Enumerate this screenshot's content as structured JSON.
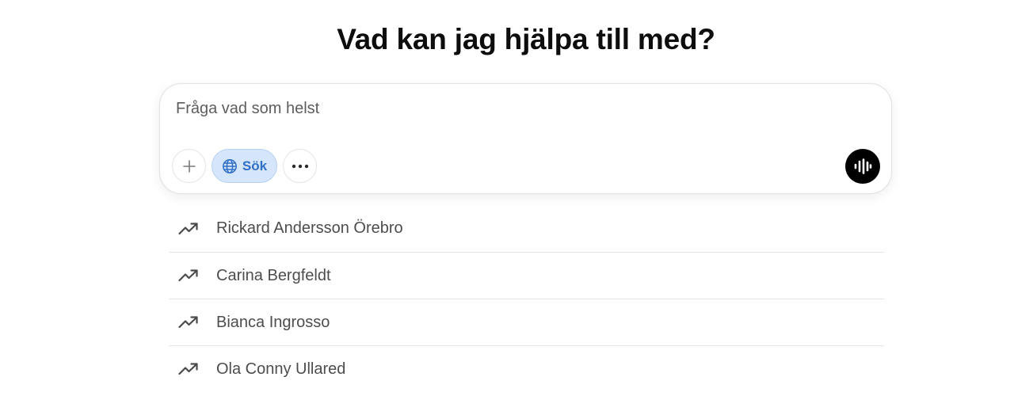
{
  "heading": "Vad kan jag hjälpa till med?",
  "composer": {
    "placeholder": "Fråga vad som helst",
    "search_label": "Sök",
    "accent_color": "#2f6fc8",
    "search_bg_color": "#d5e6fb"
  },
  "icons": {
    "plus": "plus-icon",
    "globe": "globe-icon",
    "more": "more-horizontal-icon",
    "voice": "voice-waveform-icon",
    "trend": "trending-up-icon"
  },
  "suggestions": [
    {
      "label": "Rickard Andersson Örebro"
    },
    {
      "label": "Carina Bergfeldt"
    },
    {
      "label": "Bianca Ingrosso"
    },
    {
      "label": "Ola Conny Ullared"
    }
  ]
}
